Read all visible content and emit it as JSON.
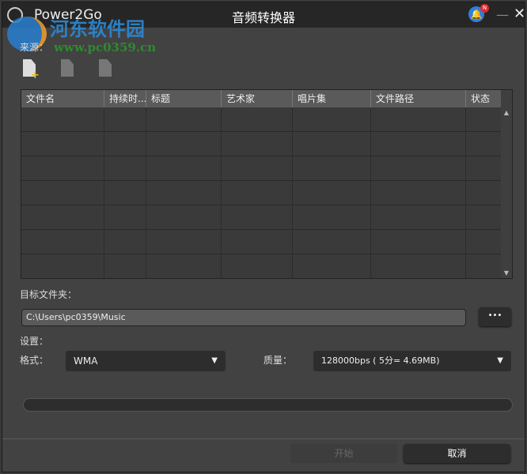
{
  "titlebar": {
    "app_name": "Power2Go",
    "title": "音频转换器",
    "notification_badge": "N"
  },
  "watermark": {
    "site_name": "河东软件园",
    "url": "www.pc0359.cn"
  },
  "source": {
    "label": "来源："
  },
  "table": {
    "columns": [
      "文件名",
      "持续时...",
      "标题",
      "艺术家",
      "唱片集",
      "文件路径",
      "状态"
    ],
    "rows": []
  },
  "destination": {
    "label": "目标文件夹：",
    "path": "C:\\Users\\pc0359\\Music",
    "browse_label": "•••"
  },
  "settings": {
    "label": "设置：",
    "format_label": "格式：",
    "format_value": "WMA",
    "quality_label": "质量：",
    "quality_value": "128000bps ( 5分= 4.69MB)"
  },
  "progress": {
    "value": 0
  },
  "buttons": {
    "start": "开始",
    "cancel": "取消"
  }
}
